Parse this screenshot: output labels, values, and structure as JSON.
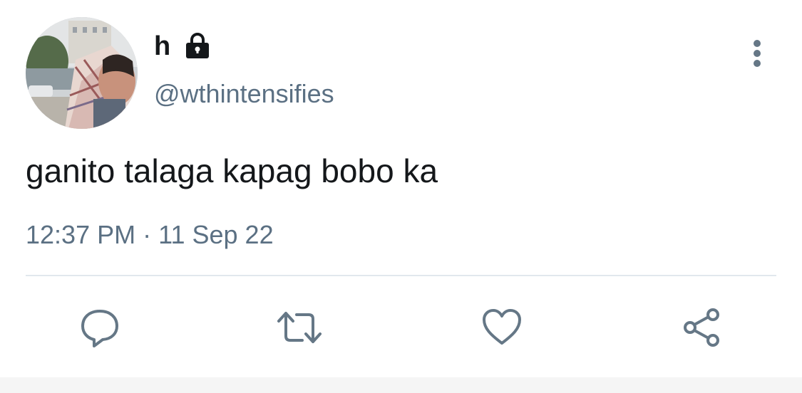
{
  "tweet": {
    "display_name": "h",
    "handle": "@wthintensifies",
    "text": "ganito talaga kapag bobo ka",
    "time": "12:37 PM",
    "separator": "·",
    "date": "11 Sep 22"
  },
  "icons": {
    "lock": "lock-icon",
    "more": "more-vertical-icon",
    "reply": "reply-icon",
    "retweet": "retweet-icon",
    "like": "heart-icon",
    "share": "share-icon"
  },
  "colors": {
    "text": "#14171a",
    "secondary": "#5b7083",
    "divider": "#e1e8ed",
    "icon": "#657786"
  }
}
